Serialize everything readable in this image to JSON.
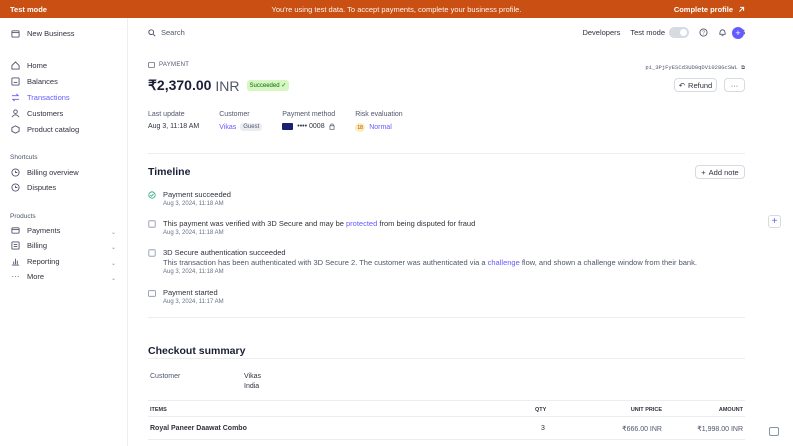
{
  "banner": {
    "left": "Test mode",
    "center": "You're using test data. To accept payments, complete your business profile.",
    "cta": "Complete profile",
    "cta_icon": "arrow-up-right-icon"
  },
  "sidebar": {
    "account": "New Business",
    "items": [
      {
        "label": "Home",
        "icon": "home-icon"
      },
      {
        "label": "Balances",
        "icon": "balances-icon"
      },
      {
        "label": "Transactions",
        "icon": "transactions-icon",
        "active": true
      },
      {
        "label": "Customers",
        "icon": "customers-icon"
      },
      {
        "label": "Product catalog",
        "icon": "product-icon"
      }
    ],
    "shortcuts_heading": "Shortcuts",
    "shortcuts": [
      {
        "label": "Billing overview",
        "icon": "clock-icon"
      },
      {
        "label": "Disputes",
        "icon": "clock-icon"
      }
    ],
    "products_heading": "Products",
    "products": [
      {
        "label": "Payments",
        "icon": "card-icon"
      },
      {
        "label": "Billing",
        "icon": "billing-icon"
      },
      {
        "label": "Reporting",
        "icon": "chart-icon"
      },
      {
        "label": "More",
        "icon": "more-icon"
      }
    ]
  },
  "topbar": {
    "search_placeholder": "Search",
    "developers": "Developers",
    "test_mode": "Test mode"
  },
  "payment": {
    "kicker": "PAYMENT",
    "amount": "₹2,370.00",
    "currency": "INR",
    "status": "Succeeded",
    "id": "pi_3PjFyESCd3UD0qDV1028GcSWL",
    "refund": "Refund",
    "more": "···"
  },
  "meta": {
    "last_update_label": "Last update",
    "last_update": "Aug 3, 11:18 AM",
    "customer_label": "Customer",
    "customer": "Vikas",
    "guest": "Guest",
    "method_label": "Payment method",
    "method": "•••• 0008",
    "risk_label": "Risk evaluation",
    "risk_score": "18",
    "risk": "Normal"
  },
  "timeline": {
    "title": "Timeline",
    "add_note": "Add note",
    "events": [
      {
        "title": "Payment succeeded",
        "date": "Aug 3, 2024, 11:18 AM"
      },
      {
        "pre": "This payment was verified with 3D Secure and may be ",
        "link": "protected",
        "post": " from being disputed for fraud",
        "date": "Aug 3, 2024, 11:18 AM"
      },
      {
        "title": "3D Secure authentication succeeded",
        "desc_pre": "This transaction has been authenticated with 3D Secure 2. The customer was authenticated via a ",
        "desc_link": "challenge",
        "desc_post": " flow, and shown a challenge window from their bank.",
        "date": "Aug 3, 2024, 11:18 AM"
      },
      {
        "title": "Payment started",
        "date": "Aug 3, 2024, 11:17 AM"
      }
    ]
  },
  "checkout": {
    "title": "Checkout summary",
    "customer_label": "Customer",
    "customer_name": "Vikas",
    "customer_country": "India",
    "headers": {
      "items": "ITEMS",
      "qty": "QTY",
      "unit_price": "UNIT PRICE",
      "amount": "AMOUNT"
    },
    "rows": [
      {
        "item": "Royal Paneer Daawat Combo",
        "qty": "3",
        "unit_price": "₹666.00 INR",
        "amount": "₹1,998.00 INR"
      }
    ]
  }
}
